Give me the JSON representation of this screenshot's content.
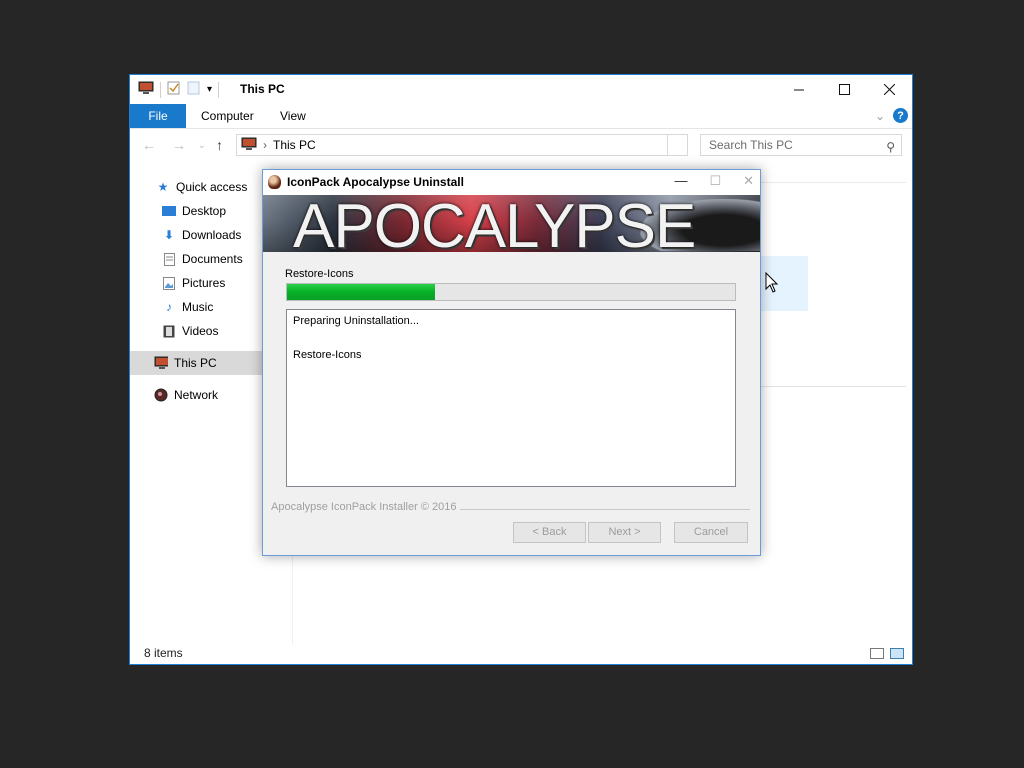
{
  "explorer": {
    "title": "This PC",
    "ribbon_tabs": [
      "File",
      "Computer",
      "View"
    ],
    "address_path": "This PC",
    "search_placeholder": "Search This PC",
    "sidebar": {
      "quick_access": "Quick access",
      "items": [
        "Desktop",
        "Downloads",
        "Documents",
        "Pictures",
        "Music",
        "Videos"
      ],
      "this_pc": "This PC",
      "network": "Network"
    },
    "status": "8 items",
    "accent": "#1979ca"
  },
  "dialog": {
    "title": "IconPack Apocalypse Uninstall",
    "banner_text": "APOCALYPSE",
    "step_label": "Restore-Icons",
    "progress": 0.33,
    "progress_color": "#06b025",
    "log": [
      "Preparing Uninstallation...",
      "",
      "Restore-Icons"
    ],
    "branding": "Apocalypse IconPack Installer © 2016",
    "buttons": {
      "back": "< Back",
      "next": "Next >",
      "cancel": "Cancel"
    }
  }
}
